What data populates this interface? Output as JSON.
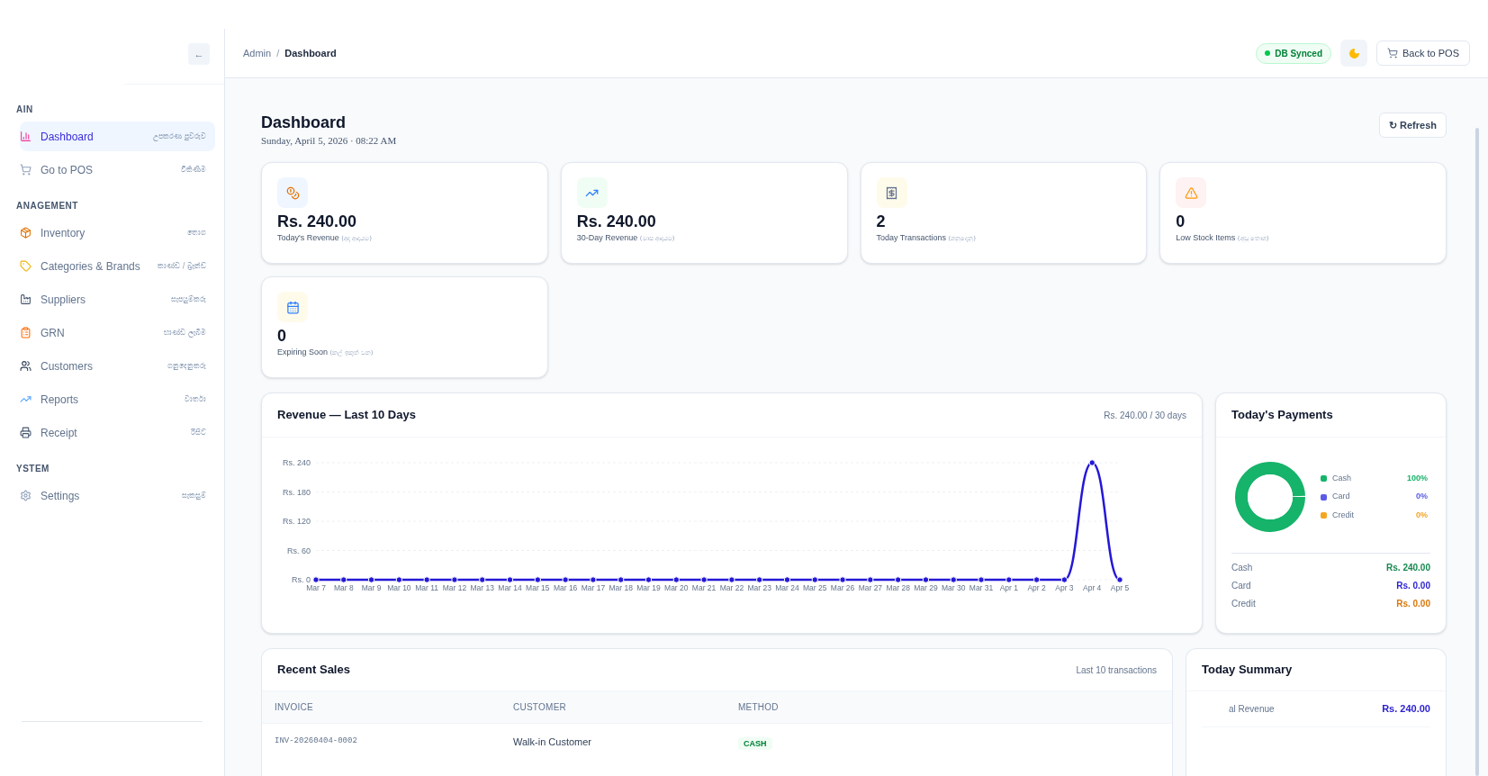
{
  "sidebar": {
    "collapse_button": "←",
    "sections": [
      {
        "title": "AIN",
        "items": [
          {
            "label": "Dashboard",
            "sub": "උපකරණ පුවරුව",
            "selected": true
          },
          {
            "label": "Go to POS",
            "sub": "විකිණීම",
            "selected": false
          }
        ]
      },
      {
        "title": "ANAGEMENT",
        "items": [
          {
            "label": "Inventory",
            "sub": "තොග",
            "selected": false
          },
          {
            "label": "Categories & Brands",
            "sub": "කාණ්ඩ / බ්‍රෑන්ඩ්",
            "selected": false
          },
          {
            "label": "Suppliers",
            "sub": "සැපයුම්කරු",
            "selected": false
          },
          {
            "label": "GRN",
            "sub": "භාණ්ඩ ලැබීම",
            "selected": false
          },
          {
            "label": "Customers",
            "sub": "ගනුදෙනුකරු",
            "selected": false
          },
          {
            "label": "Reports",
            "sub": "වාර්තා",
            "selected": false
          },
          {
            "label": "Receipt",
            "sub": "රිසිට්",
            "selected": false
          }
        ]
      },
      {
        "title": "YSTEM",
        "items": [
          {
            "label": "Settings",
            "sub": "සැකසුම්",
            "selected": false
          }
        ]
      }
    ]
  },
  "header": {
    "breadcrumb": [
      "Admin",
      "Dashboard"
    ],
    "breadcrumb_separator": "/",
    "sync_badge": "DB Synced",
    "back_button": "Back to POS"
  },
  "page": {
    "title": "Dashboard",
    "date": "Sunday, April 5, 2026 · 08:22 AM",
    "refresh_button": "↻ Refresh"
  },
  "stats": [
    {
      "value": "Rs. 240.00",
      "label": "Today's Revenue",
      "sub": "(අද ආදායම)"
    },
    {
      "value": "Rs. 240.00",
      "label": "30-Day Revenue",
      "sub": "(මාස ආදායම)"
    },
    {
      "value": "2",
      "label": "Today Transactions",
      "sub": "(ගනුදෙනු)"
    },
    {
      "value": "0",
      "label": "Low Stock Items",
      "sub": "(අඩු තොග)"
    },
    {
      "value": "0",
      "label": "Expiring Soon",
      "sub": "(කල් ඉකුත් වන)"
    }
  ],
  "revenue": {
    "title": "Revenue — Last 10 Days",
    "summary": "Rs. 240.00 / 30 days",
    "chart_data": {
      "type": "line",
      "categories": [
        "Mar 7",
        "Mar 8",
        "Mar 9",
        "Mar 10",
        "Mar 11",
        "Mar 12",
        "Mar 13",
        "Mar 14",
        "Mar 15",
        "Mar 16",
        "Mar 17",
        "Mar 18",
        "Mar 19",
        "Mar 20",
        "Mar 21",
        "Mar 22",
        "Mar 23",
        "Mar 24",
        "Mar 25",
        "Mar 26",
        "Mar 27",
        "Mar 28",
        "Mar 29",
        "Mar 30",
        "Mar 31",
        "Apr 1",
        "Apr 2",
        "Apr 3",
        "Apr 4",
        "Apr 5"
      ],
      "series": [
        {
          "color": "#2418d6",
          "marker": true,
          "values": [
            0,
            0,
            0,
            0,
            0,
            0,
            0,
            0,
            0,
            0,
            0,
            0,
            0,
            0,
            0,
            0,
            0,
            0,
            0,
            0,
            0,
            0,
            0,
            0,
            0,
            0,
            0,
            0,
            240,
            0
          ]
        }
      ],
      "grid": true,
      "ylim": [
        0,
        240
      ],
      "yticks": [
        {
          "value": 0,
          "label": "Rs. 0"
        },
        {
          "value": 60,
          "label": "Rs. 60"
        },
        {
          "value": 120,
          "label": "Rs. 120"
        },
        {
          "value": 180,
          "label": "Rs. 180"
        },
        {
          "value": 240,
          "label": "Rs. 240"
        }
      ]
    }
  },
  "payments": {
    "title": "Today's Payments",
    "chart_data": {
      "type": "donut",
      "categories": [
        "Cash",
        "Card",
        "Credit"
      ],
      "values": [
        100,
        0,
        0
      ]
    },
    "legend": [
      {
        "percent": "100%",
        "color": "#16b36a"
      },
      {
        "percent": "0%",
        "color": "#5b5be6"
      },
      {
        "percent": "0%",
        "color": "#f5a524"
      }
    ],
    "totals": [
      {
        "name": "Cash",
        "amount": "Rs. 240.00",
        "color": "#15894f"
      },
      {
        "name": "Card",
        "amount": "Rs. 0.00",
        "color": "#2a1fd0"
      },
      {
        "name": "Credit",
        "amount": "Rs. 0.00",
        "color": "#d9770b"
      }
    ]
  },
  "recent_sales": {
    "title": "Recent Sales",
    "note": "Last 10 transactions",
    "columns": [
      "INVOICE",
      "CUSTOMER",
      "METHOD"
    ],
    "rows": [
      {
        "invoice": "INV-20260404-0002",
        "customer": "Walk-in Customer",
        "method": "CASH"
      }
    ]
  },
  "today_summary": {
    "title": "Today Summary",
    "rows": [
      {
        "label": "al Revenue",
        "value": "Rs. 240.00"
      }
    ]
  }
}
